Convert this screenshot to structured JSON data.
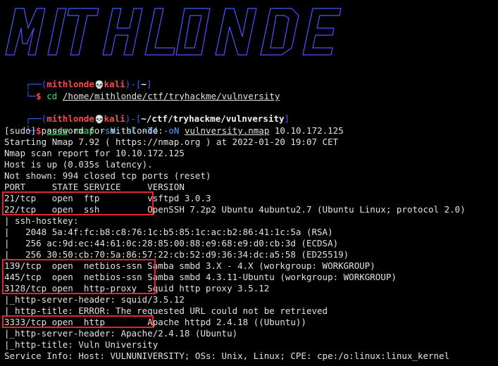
{
  "colors": {
    "background": "#000000",
    "text": "#e2e2e2",
    "prompt_frame": "#2f6bff",
    "prompt_user": "#ff4a4a",
    "command": "#38e06a",
    "argument": "#4aa3ff",
    "highlight_box": "#e3262b"
  },
  "banner": {
    "art": [
      " __  __  _____  ____   __  __  __    _____  ____   _____ _____ ",
      "|  \\/  ||_   _||  _ \\ |  \\/  ||  |  |_   _||  _ \\ | ____||_   _|",
      "| |\\/| |  | |  | |_) || |\\/| ||  |    | |  | |_) ||  _|    | |  ",
      "| |  | |  | |  |  _ < | |  | ||  |__  | |  |  __/ | |___   | |  ",
      "|_|  |_|  |_|  |_| \\_\\|_|  |_||_____| |_|  |_|    |_____|  |_|  "
    ],
    "icon": "ascii-art-banner"
  },
  "prompt1": {
    "user": "mithlonde",
    "host": "kali",
    "dir": "~",
    "skull": "skull-icon",
    "cmd": "cd",
    "path": "/home/mithlonde/ctf/tryhackme/vulnversity"
  },
  "prompt2": {
    "user": "mithlonde",
    "host": "kali",
    "dir": "~/ctf/tryhackme/vulnversity",
    "skull": "skull-icon",
    "cmd": "sudo",
    "tool": "nmap",
    "flags": "-sV -sC -T4 -oN",
    "outfile": "vulnversity.nmap",
    "target": "10.10.172.125"
  },
  "output": {
    "l1": "[sudo] password for mithlonde:",
    "l2": "Starting Nmap 7.92 ( https://nmap.org ) at 2022-01-20 19:07 CET",
    "l3": "Nmap scan report for 10.10.172.125",
    "l4": "Host is up (0.035s latency).",
    "l5": "Not shown: 994 closed tcp ports (reset)",
    "l6": "PORT     STATE SERVICE     VERSION",
    "l7": "21/tcp   open  ftp         vsftpd 3.0.3",
    "l8": "22/tcp   open  ssh         OpenSSH 7.2p2 Ubuntu 4ubuntu2.7 (Ubuntu Linux; protocol 2.0)",
    "l9": "| ssh-hostkey:",
    "l10": "|   2048 5a:4f:fc:b8:c8:76:1c:b5:85:1c:ac:b2:86:41:1c:5a (RSA)",
    "l11": "|   256 ac:9d:ec:44:61:0c:28:85:00:88:e9:68:e9:d0:cb:3d (ECDSA)",
    "l12": "|_  256 30:50:cb:70:5a:86:57:22:cb:52:d9:36:34:dc:a5:58 (ED25519)",
    "l13": "139/tcp  open  netbios-ssn Samba smbd 3.X - 4.X (workgroup: WORKGROUP)",
    "l14": "445/tcp  open  netbios-ssn Samba smbd 4.3.11-Ubuntu (workgroup: WORKGROUP)",
    "l15": "3128/tcp open  http-proxy  Squid http proxy 3.5.12",
    "l16": "|_http-server-header: squid/3.5.12",
    "l17": "|_http-title: ERROR: The requested URL could not be retrieved",
    "l18": "3333/tcp open  http        Apache httpd 2.4.18 ((Ubuntu))",
    "l19": "|_http-server-header: Apache/2.4.18 (Ubuntu)",
    "l20": "|_http-title: Vuln University",
    "l21": "Service Info: Host: VULNUNIVERSITY; OSs: Unix, Linux; CPE: cpe:/o:linux:linux_kernel"
  }
}
